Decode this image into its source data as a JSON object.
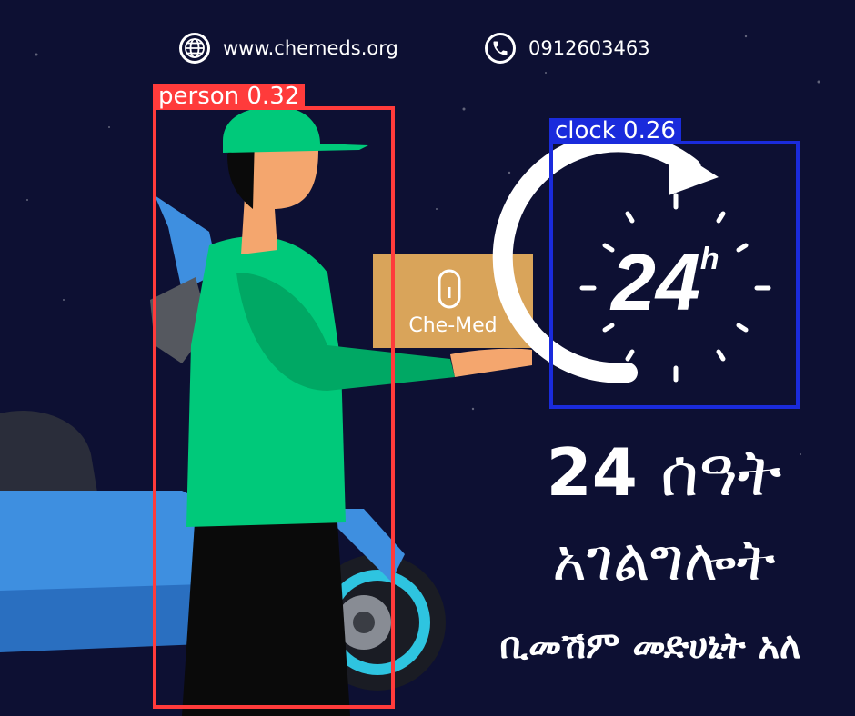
{
  "contact": {
    "website": "www.chemeds.org",
    "website_icon": "globe-icon",
    "phone": "0912603463",
    "phone_icon": "phone-icon"
  },
  "package": {
    "brand": "Che-Med",
    "logo": "pill-capsule-icon"
  },
  "clock_graphic": {
    "text": "24",
    "suffix": "h"
  },
  "detections": [
    {
      "label": "person 0.32",
      "color": "#ff3b3b"
    },
    {
      "label": "clock 0.26",
      "color": "#1a2bdc"
    }
  ],
  "headline": {
    "line1_number": "24",
    "line1_word": "ሰዓት",
    "line2": "አገልግሎት",
    "line3": "ቢመሽም መድሀኒት አለ"
  },
  "colors": {
    "background": "#0d1033",
    "shirt": "#00c97a",
    "box": "#d9a45a",
    "scooter": "#3e8fe0"
  }
}
